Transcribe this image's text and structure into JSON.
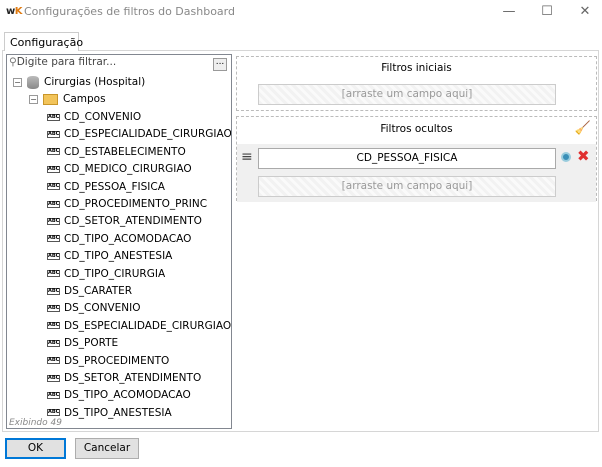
{
  "window": {
    "logo": "wK",
    "title": "Configurações de filtros do Dashboard",
    "minimize": "—",
    "maximize": "☐",
    "close": "✕"
  },
  "tab": "Configuração",
  "tree": {
    "filter_placeholder": "Digite para filtrar...",
    "more": "...",
    "root": "Cirurgias (Hospital)",
    "folder": "Campos",
    "fields": [
      "CD_CONVENIO",
      "CD_ESPECIALIDADE_CIRURGIAO",
      "CD_ESTABELECIMENTO",
      "CD_MEDICO_CIRURGIAO",
      "CD_PESSOA_FISICA",
      "CD_PROCEDIMENTO_PRINC",
      "CD_SETOR_ATENDIMENTO",
      "CD_TIPO_ACOMODACAO",
      "CD_TIPO_ANESTESIA",
      "CD_TIPO_CIRURGIA",
      "DS_CARATER",
      "DS_CONVENIO",
      "DS_ESPECIALIDADE_CIRURGIAO",
      "DS_PORTE",
      "DS_PROCEDIMENTO",
      "DS_SETOR_ATENDIMENTO",
      "DS_TIPO_ACOMODACAO",
      "DS_TIPO_ANESTESIA"
    ],
    "status": "Exibindo 49"
  },
  "initial": {
    "title": "Filtros iniciais",
    "drop": "[arraste um campo aqui]"
  },
  "hidden": {
    "title": "Filtros ocultos",
    "field": "CD_PESSOA_FISICA",
    "drop": "[arraste um campo aqui]"
  },
  "buttons": {
    "ok": "OK",
    "cancel": "Cancelar"
  }
}
